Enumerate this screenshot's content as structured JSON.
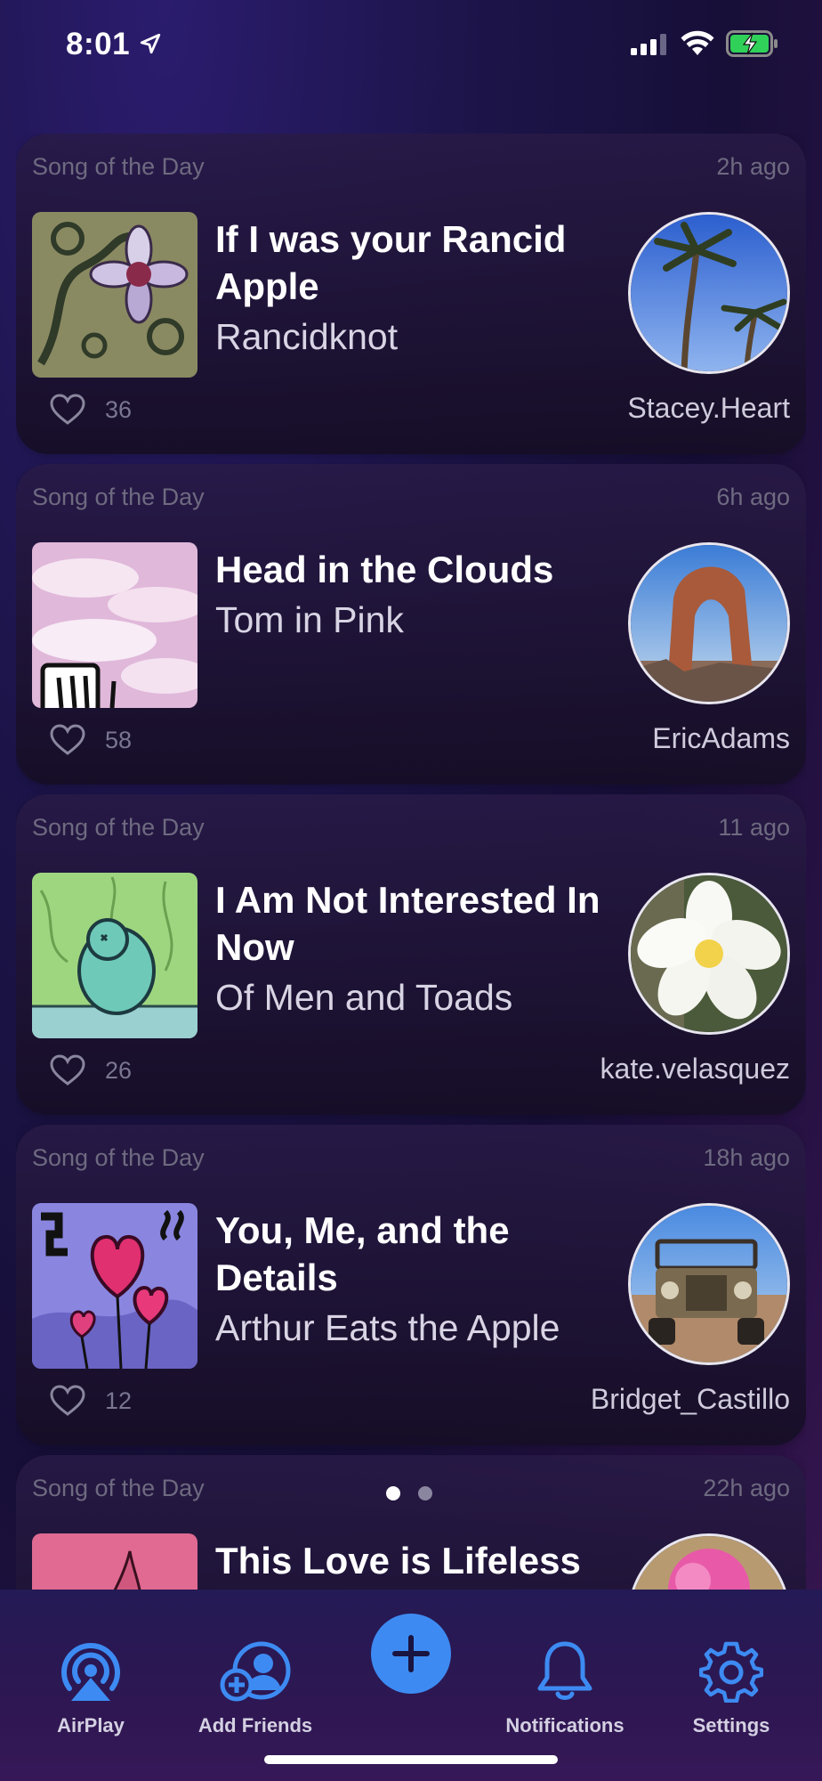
{
  "status_bar": {
    "time": "8:01"
  },
  "feed": {
    "cards": [
      {
        "label": "Song of the Day",
        "time": "2h ago",
        "title": "If I was your Rancid Apple",
        "artist": "Rancidknot",
        "likes": "36",
        "user": "Stacey.Heart",
        "art": "flower-vine-art",
        "avatar": "palm-trees-avatar"
      },
      {
        "label": "Song of the Day",
        "time": "6h ago",
        "title": "Head in the Clouds",
        "artist": "Tom in Pink",
        "likes": "58",
        "user": "EricAdams",
        "art": "pink-clouds-art",
        "avatar": "rock-arch-avatar"
      },
      {
        "label": "Song of the Day",
        "time": "11 ago",
        "title": "I Am Not Interested In Now",
        "artist": "Of Men and Toads",
        "likes": "26",
        "user": "kate.velasquez",
        "art": "green-toad-art",
        "avatar": "white-flower-avatar"
      },
      {
        "label": "Song of the Day",
        "time": "18h ago",
        "title": "You, Me, and the Details",
        "artist": "Arthur Eats the Apple",
        "likes": "12",
        "user": "Bridget_Castillo",
        "art": "heart-balloons-art",
        "avatar": "old-jeep-avatar"
      },
      {
        "label": "Song of the Day",
        "time": "22h ago",
        "title": "This Love is Lifeless",
        "artist": "",
        "likes": "",
        "user": "",
        "art": "pink-plant-art",
        "avatar": "pink-flower-avatar"
      }
    ]
  },
  "tab_bar": {
    "airplay": "AirPlay",
    "add_friends": "Add Friends",
    "notifications": "Notifications",
    "settings": "Settings"
  },
  "page_indicator": {
    "pages": 2,
    "current": 1
  },
  "colors": {
    "accent": "#3d8bf2",
    "icon_blue": "#3d8bf2",
    "card_bg": "#1d1432"
  }
}
